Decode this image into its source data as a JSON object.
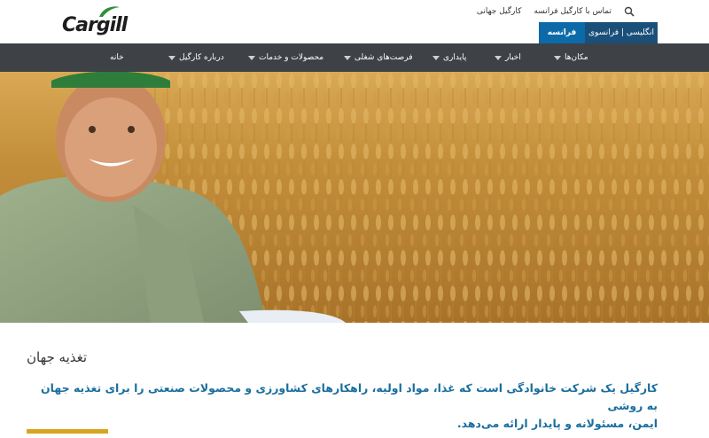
{
  "brand": {
    "name": "Cargill",
    "accent_green": "#2f8f3a",
    "nav_bg": "#3e4145",
    "lang_en_bg": "#1a4f7a",
    "lang_fa_bg": "#0d6aa8",
    "headline_color": "#1a6e9e",
    "accent_bar": "#d8a51f"
  },
  "utility": {
    "contact_link": "تماس با کارگیل فرانسه",
    "global_link": "کارگیل جهانی",
    "search_icon": "search-icon"
  },
  "language": {
    "english_label": "انگلیسی | فرانسوی",
    "farsi_label": "فرانسه"
  },
  "nav": {
    "items": [
      {
        "label": "خانه",
        "has_caret": false
      },
      {
        "label": "درباره کارگیل",
        "has_caret": true
      },
      {
        "label": "محصولات و خدمات",
        "has_caret": true
      },
      {
        "label": "فرصت‌های شغلی",
        "has_caret": true
      },
      {
        "label": "پایداری",
        "has_caret": true
      },
      {
        "label": "اخبار",
        "has_caret": true
      },
      {
        "label": "مکان‌ها",
        "has_caret": true
      }
    ]
  },
  "hero": {
    "image_alt": "farmer-in-wheat-field"
  },
  "main": {
    "headline": "تغذیه جهان",
    "intro_line1": "کارگیل یک شرکت خانوادگی است که غذا، مواد اولیه، راهکارهای کشاورزی و محصولات صنعتی را برای تغذیه جهان به روشی",
    "intro_line2": "ایمن، مسئولانه و پایدار ارائه می‌دهد."
  }
}
